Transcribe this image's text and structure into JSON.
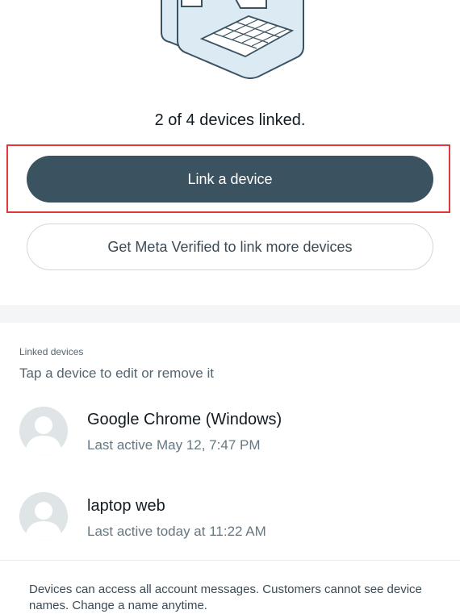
{
  "summary": {
    "linked_count_text": "2 of 4 devices linked."
  },
  "actions": {
    "link_device_label": "Link a device",
    "meta_verified_label": "Get Meta Verified to link more devices"
  },
  "linked_devices": {
    "header": "Linked devices",
    "subheader": "Tap a device to edit or remove it",
    "items": [
      {
        "name": "Google Chrome (Windows)",
        "last_active": "Last active May 12, 7:47 PM"
      },
      {
        "name": "laptop web",
        "last_active": "Last active today at 11:22 AM"
      }
    ]
  },
  "footer": {
    "note": "Devices can access all account messages. Customers cannot see device names. Change a name anytime."
  },
  "colors": {
    "primary_button": "#3b5361",
    "highlight_border": "#e0363c",
    "illustration_fill": "#dbeaf3",
    "illustration_stroke": "#3b5361"
  },
  "icons": {
    "illustration": "laptop-and-phones-illustration",
    "avatar": "default-avatar-icon"
  }
}
